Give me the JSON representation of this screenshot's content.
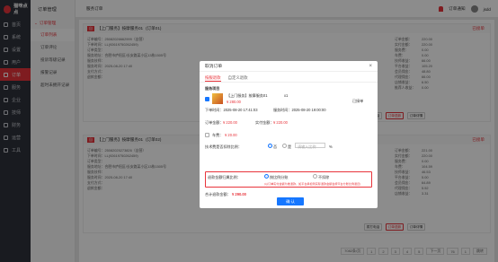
{
  "app": {
    "logo": "猫咪点点"
  },
  "sidebar": {
    "items": [
      {
        "label": "首页",
        "icon": "home-icon"
      },
      {
        "label": "系统",
        "icon": "system-icon"
      },
      {
        "label": "设置",
        "icon": "settings-icon"
      },
      {
        "label": "用户",
        "icon": "user-icon"
      },
      {
        "label": "订单",
        "icon": "order-icon"
      },
      {
        "label": "服务",
        "icon": "service-icon"
      },
      {
        "label": "企业",
        "icon": "enterprise-icon"
      },
      {
        "label": "技师",
        "icon": "technician-icon"
      },
      {
        "label": "财务",
        "icon": "finance-icon"
      },
      {
        "label": "运营",
        "icon": "operation-icon"
      },
      {
        "label": "工具",
        "icon": "tool-icon"
      }
    ]
  },
  "subnav": {
    "head": "订单管理",
    "group": "订单管理",
    "items": [
      "订单列表",
      "订单评论",
      "投诉等级记录",
      "报警记录",
      "超时未拥开记录"
    ]
  },
  "topbar": {
    "title": "服务订单",
    "notice": "订单通知",
    "user": "jsdd"
  },
  "orders": [
    {
      "title": "【上门服务】按摩服务01",
      "sub": "(订单01)",
      "status": "已接单",
      "no": "订单编号：25082026662999（自营）",
      "from": "下单时间：LL(92619750262459)",
      "type": "订单类型：",
      "addr": "服务地址：合肥市庐阳区/长安路某小区13栋1505号",
      "tech": "服务技师：",
      "time": "服务时间：2025-08-20 17:40",
      "payway": "支付方式：",
      "refund": "退款金额：",
      "right": [
        [
          "订单金额：",
          "220.00"
        ],
        [
          "实付金额：",
          "220.00"
        ],
        [
          "服务费：",
          "0.00"
        ],
        [
          "车费：",
          "0.00"
        ],
        [
          "技师收益：",
          "66.00"
        ],
        [
          "平台收益：",
          "105.20"
        ],
        [
          "会员佣金：",
          "48.80"
        ],
        [
          "代理佣金：",
          "66.00"
        ],
        [
          "店铺收益：",
          "6.50"
        ],
        [
          "推荐人收益：",
          "0.00"
        ]
      ]
    },
    {
      "title": "【上门服务】按摩服务01",
      "sub": "(订单02)",
      "status": "已接单",
      "no": "订单编号：25082025273826（自营）",
      "from": "下单时间：LL(92619750262459)",
      "type": "订单类型：",
      "addr": "服务地址：合肥市庐阳区/长安路某小区13栋1505号",
      "tech": "服务技师：",
      "time": "服务时间：2025-08-20 17:40",
      "payway": "支付方式：",
      "refund": "退款金额：",
      "right": [
        [
          "订单金额：",
          "221.00"
        ],
        [
          "实付金额：",
          "220.00"
        ],
        [
          "服务费：",
          "0.00"
        ],
        [
          "车费：",
          "104.59"
        ],
        [
          "技师收益：",
          "46.53"
        ],
        [
          "平台收益：",
          "5.00"
        ],
        [
          "会员佣金：",
          "64.89"
        ],
        [
          "代理佣金：",
          "5.52"
        ],
        [
          "店铺收益：",
          "3.31"
        ]
      ]
    }
  ],
  "buttons": {
    "call": "拨打电话",
    "refund": "订单退款",
    "detail": "订单详情"
  },
  "pager": {
    "total": "7082条/页",
    "pages": [
      "1",
      "2",
      "3",
      "4",
      "5",
      "下一页",
      "76",
      "1",
      "跳转"
    ]
  },
  "modal": {
    "title": "取消订单",
    "tabs": [
      "按服退款",
      "自定义退款"
    ],
    "section": "服务项目",
    "item_name": "【上门服务】按摩服务01",
    "item_qty": "x1",
    "item_price": "¥ 280.00",
    "item_status": "已接单",
    "order_time": "下单时间：2025-08-20 17:41:03",
    "service_time": "服务时间：2025-08-20 19:00:00",
    "order_amount_label": "订单金额：",
    "order_amount": "¥ 220.00",
    "paid_label": "实付金额：",
    "paid": "¥ 220.00",
    "car_fee_label": "车费：",
    "car_fee": "¥ 20.00",
    "deduct_label": "技术费是否扣除比例：",
    "opt_yes": "否",
    "opt_no": "是",
    "deduct_placeholder": "请输入比例",
    "pct": "%",
    "refund_way_label": "退款金额归属比例：",
    "refund_way1": "按比例分账",
    "refund_way2": "不扣除",
    "refund_hint": "(以订单实付金额为准退款，如平台承担则实际退款金额会按平台分账比例退还)",
    "total_label": "合计退款金额：",
    "total": "¥ 290.00",
    "ok": "确 认"
  }
}
